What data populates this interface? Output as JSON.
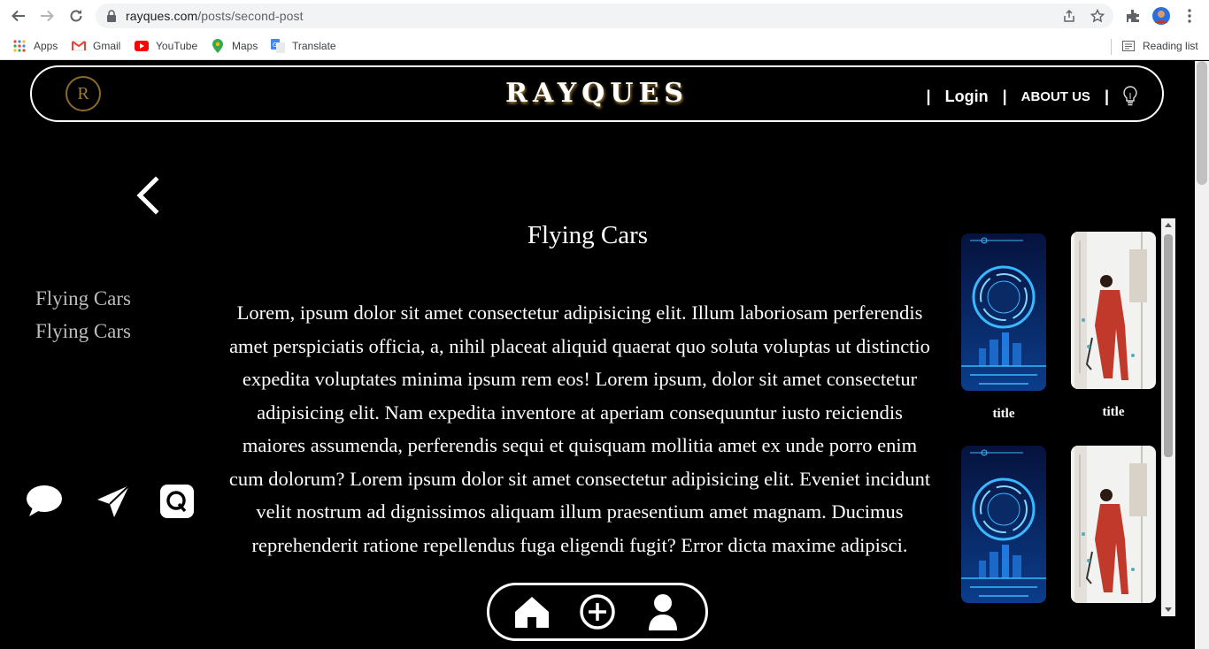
{
  "browser": {
    "url_host": "rayques.com",
    "url_path": "/posts/second-post",
    "bookmarks": [
      {
        "label": "Apps",
        "icon": "apps-grid-icon"
      },
      {
        "label": "Gmail",
        "icon": "gmail-icon"
      },
      {
        "label": "YouTube",
        "icon": "youtube-icon"
      },
      {
        "label": "Maps",
        "icon": "maps-icon"
      },
      {
        "label": "Translate",
        "icon": "translate-icon"
      }
    ],
    "reading_list": "Reading list"
  },
  "header": {
    "logo_letter": "R",
    "brand": "RAYQUES",
    "separator": "|",
    "login": "Login",
    "about": "ABOUT US"
  },
  "sidebar": {
    "items": [
      "Flying Cars",
      "Flying Cars"
    ]
  },
  "post": {
    "title": "Flying Cars",
    "body": "Lorem, ipsum dolor sit amet consectetur adipisicing elit. Illum laboriosam perferendis amet perspiciatis officia, a, nihil placeat aliquid quaerat quo soluta voluptas ut distinctio expedita voluptates minima ipsum rem eos! Lorem ipsum, dolor sit amet consectetur adipisicing elit. Nam expedita inventore at aperiam consequuntur iusto reiciendis maiores assumenda, perferendis sequi et quisquam mollitia amet ex unde porro enim cum dolorum? Lorem ipsum dolor sit amet consectetur adipisicing elit. Eveniet incidunt velit nostrum ad dignissimos aliquam illum praesentium amet magnam. Ducimus reprehenderit ratione repellendus fuga eligendi fugit? Error dicta maxime adipisci."
  },
  "gallery": {
    "cards": [
      {
        "caption": "title",
        "image": "tech-circle"
      },
      {
        "caption": "title",
        "image": "fashion-sketch"
      },
      {
        "caption": "",
        "image": "tech-circle"
      },
      {
        "caption": "",
        "image": "fashion-sketch"
      }
    ]
  },
  "colors": {
    "background": "#000000",
    "text": "#ffffff",
    "accent_gold": "#b08a3a",
    "sidebar_text": "#bdbdbd"
  }
}
